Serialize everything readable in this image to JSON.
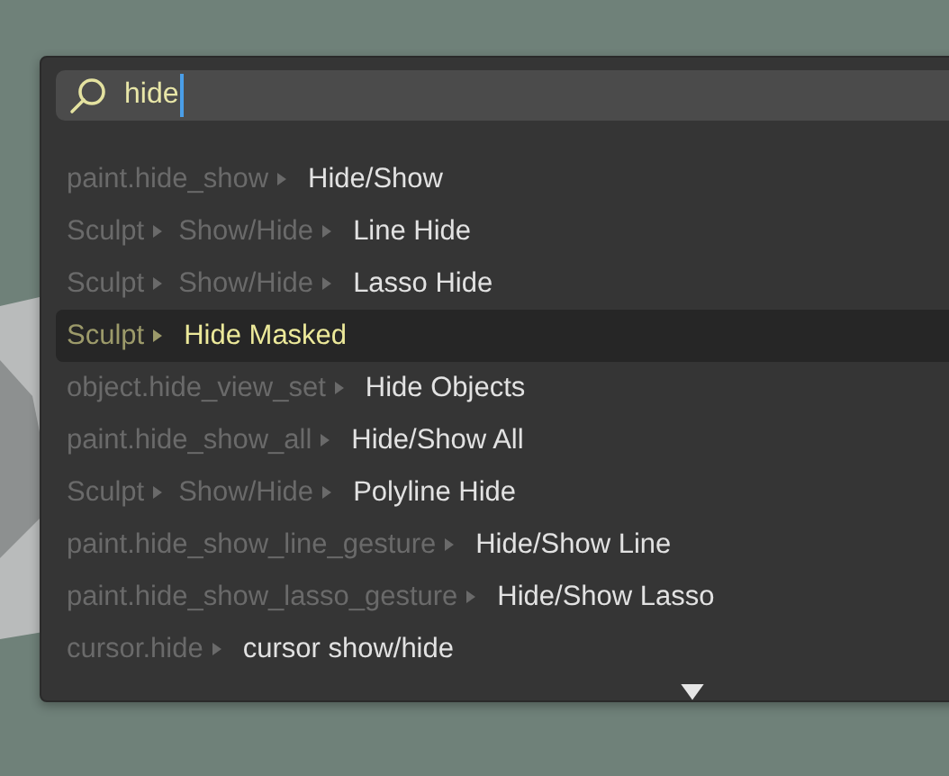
{
  "search": {
    "value": "hide"
  },
  "results": [
    {
      "path": [
        "paint.hide_show"
      ],
      "label": "Hide/Show",
      "selected": false
    },
    {
      "path": [
        "Sculpt",
        "Show/Hide"
      ],
      "label": "Line Hide",
      "selected": false
    },
    {
      "path": [
        "Sculpt",
        "Show/Hide"
      ],
      "label": "Lasso Hide",
      "selected": false
    },
    {
      "path": [
        "Sculpt"
      ],
      "label": "Hide Masked",
      "selected": true
    },
    {
      "path": [
        "object.hide_view_set"
      ],
      "label": "Hide Objects",
      "selected": false
    },
    {
      "path": [
        "paint.hide_show_all"
      ],
      "label": "Hide/Show All",
      "selected": false
    },
    {
      "path": [
        "Sculpt",
        "Show/Hide"
      ],
      "label": "Polyline Hide",
      "selected": false
    },
    {
      "path": [
        "paint.hide_show_line_gesture"
      ],
      "label": "Hide/Show Line",
      "selected": false
    },
    {
      "path": [
        "paint.hide_show_lasso_gesture"
      ],
      "label": "Hide/Show Lasso",
      "selected": false
    },
    {
      "path": [
        "cursor.hide"
      ],
      "label": "cursor show/hide",
      "selected": false
    }
  ]
}
